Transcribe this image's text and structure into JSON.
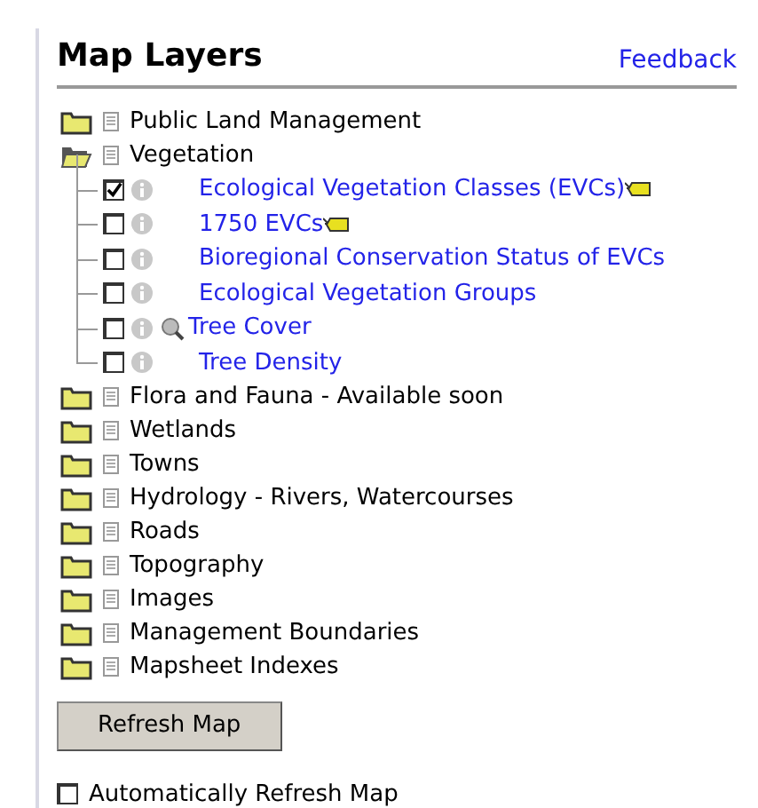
{
  "title": "Map Layers",
  "feedback": "Feedback",
  "groups": [
    {
      "label": "Public Land Management",
      "expanded": false
    },
    {
      "label": "Vegetation",
      "expanded": true,
      "layers": [
        {
          "label": "Ecological Vegetation Classes (EVCs)",
          "checked": true,
          "legend": true,
          "scale_hint": false
        },
        {
          "label": "1750 EVCs",
          "checked": false,
          "legend": true,
          "scale_hint": false
        },
        {
          "label": "Bioregional Conservation Status of EVCs",
          "checked": false,
          "legend": false,
          "scale_hint": false
        },
        {
          "label": "Ecological Vegetation Groups",
          "checked": false,
          "legend": false,
          "scale_hint": false
        },
        {
          "label": "Tree Cover",
          "checked": false,
          "legend": false,
          "scale_hint": true
        },
        {
          "label": "Tree Density",
          "checked": false,
          "legend": false,
          "scale_hint": false
        }
      ]
    },
    {
      "label": "Flora and Fauna - Available soon",
      "expanded": false
    },
    {
      "label": "Wetlands",
      "expanded": false
    },
    {
      "label": "Towns",
      "expanded": false
    },
    {
      "label": "Hydrology - Rivers, Watercourses",
      "expanded": false
    },
    {
      "label": "Roads",
      "expanded": false
    },
    {
      "label": "Topography",
      "expanded": false
    },
    {
      "label": "Images",
      "expanded": false
    },
    {
      "label": "Management Boundaries",
      "expanded": false
    },
    {
      "label": "Mapsheet Indexes",
      "expanded": false
    }
  ],
  "refresh_button": "Refresh Map",
  "auto_refresh": {
    "label": "Automatically Refresh Map",
    "checked": false
  }
}
